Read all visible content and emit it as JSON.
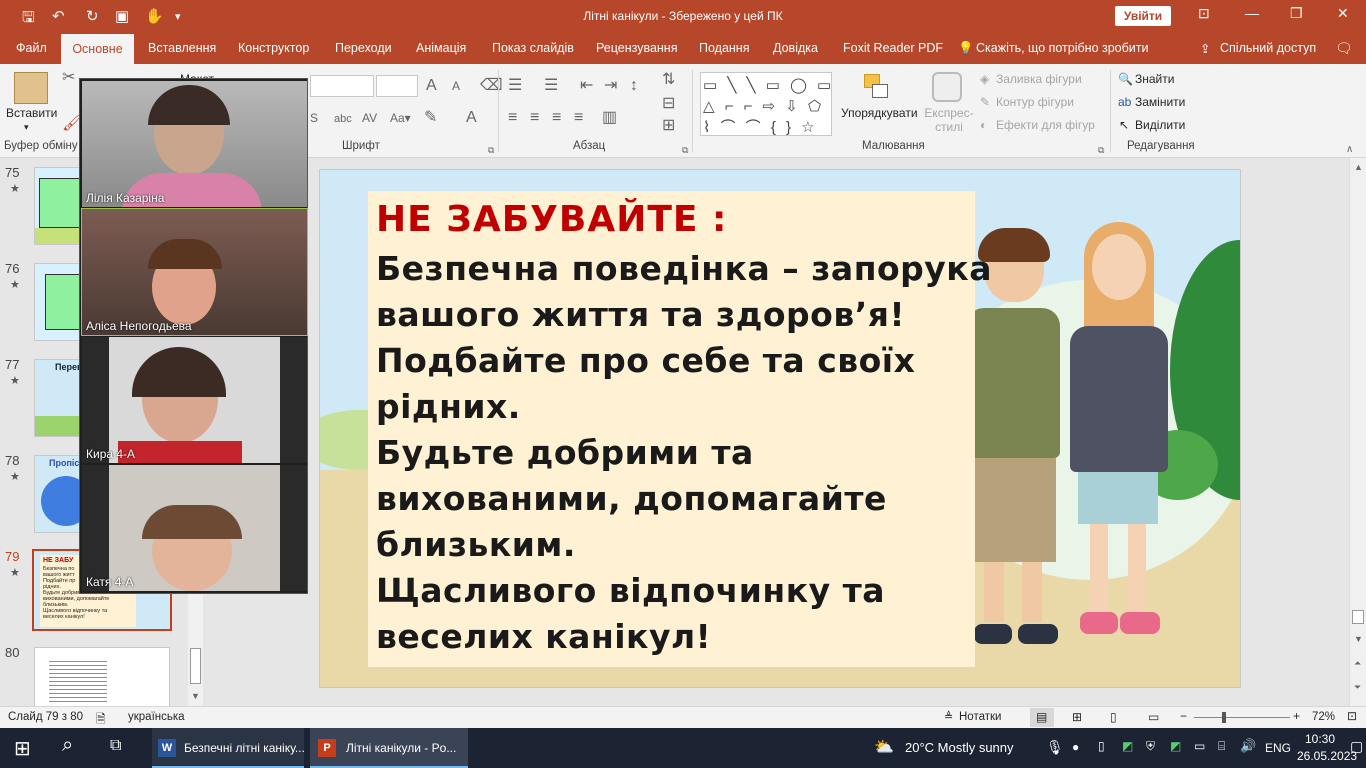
{
  "app": {
    "title": "Літні канікули  -  Збережено у цей ПК",
    "signin_label": "Увійти"
  },
  "tabs": [
    "Файл",
    "Основне",
    "Вставлення",
    "Конструктор",
    "Переходи",
    "Анімація",
    "Показ слайдів",
    "Рецензування",
    "Подання",
    "Довідка",
    "Foxit Reader PDF",
    "Скажіть, що потрібно зробити",
    "Спільний доступ"
  ],
  "ribbon": {
    "paste_label": "Вставити",
    "clipboard_label": "Буфер обміну",
    "layout_label": "Макет",
    "font_label": "Шрифт",
    "paragraph_label": "Абзац",
    "drawing_label": "Малювання",
    "arrange_label": "Упорядкувати",
    "quickstyles_label": "Експрес-стилі",
    "fill_label": "Заливка фігури",
    "outline_label": "Контур фігури",
    "effects_label": "Ефекти для фігур",
    "find_label": "Знайти",
    "replace_label": "Замінити",
    "select_label": "Виділити",
    "editing_label": "Редагування"
  },
  "thumbnails": [
    {
      "num": "75",
      "star": "★"
    },
    {
      "num": "76",
      "star": "★"
    },
    {
      "num": "77",
      "star": "★",
      "title": "Перев"
    },
    {
      "num": "78",
      "star": "★",
      "title": "Пропіс"
    },
    {
      "num": "79",
      "star": "★",
      "title": "НЕ ЗАБУ",
      "selected": true,
      "lines": [
        "Безпечна по",
        "вашого житт",
        "Подбайте пр",
        "рідних.",
        "Будьте добрими та",
        "вихованими, допомагайте",
        "близьким.",
        "Щасливого відпочинку та",
        "веселих канікул!"
      ]
    },
    {
      "num": "80",
      "star": ""
    }
  ],
  "video_participants": [
    {
      "name": "Лілія Казаріна"
    },
    {
      "name": "Аліса Непогодьева"
    },
    {
      "name": "Кира 4-А"
    },
    {
      "name": "Катя  4-А"
    }
  ],
  "slide": {
    "heading": "НЕ ЗАБУВАЙТЕ :",
    "lines": [
      "Безпечна поведінка – запорука",
      "вашого життя та здоров’я!",
      "Подбайте про себе та своїх",
      "рідних.",
      "Будьте добрими та",
      "вихованими, допомагайте",
      "близьким.",
      "Щасливого відпочинку та",
      "веселих канікул!"
    ]
  },
  "statusbar": {
    "slide_info": "Слайд 79 з 80",
    "language": "українська",
    "notes_label": "Нотатки",
    "zoom": "72%"
  },
  "taskbar": {
    "app1": "Безпечні літні каніку...",
    "app2": "Літні канікули - Po...",
    "weather": "20°C  Mostly sunny",
    "lang": "ENG",
    "time": "10:30",
    "date": "26.05.2023"
  },
  "colors": {
    "accent": "#b7472a",
    "heading": "#c00000",
    "panel": "#fff1d3"
  }
}
